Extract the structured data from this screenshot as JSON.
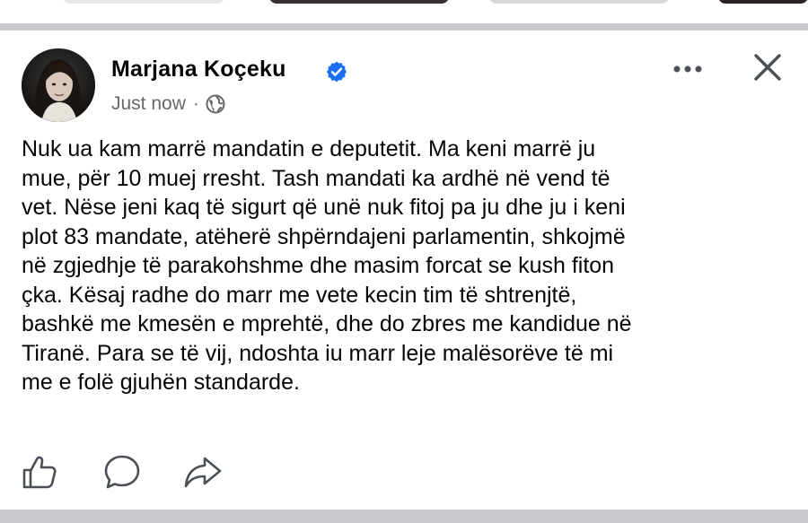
{
  "post": {
    "author": "Marjana Koçeku",
    "verified": true,
    "timestamp": "Just now",
    "separator": "·",
    "audience_icon": "globe-icon",
    "text_lines": [
      "Nuk ua kam marrë mandatin e deputetit. Ma keni marrë ju",
      "mue, për 10 muej rresht. Tash mandati ka ardhë në vend të",
      "vet. Nëse jeni kaq të sigurt që unë nuk fitoj pa ju dhe ju i keni",
      "plot 83 mandate, atëherë shpërndajeni parlamentin, shkojmë",
      "në zgjedhje të parakohshme dhe masim forcat se kush fiton",
      "çka. Kësaj radhe do marr me vete kecin tim të shtrenjtë,",
      "bashkë me kmesën e mprehtë, dhe do zbres me kandidue në",
      "Tiranë. Para se të vij, ndoshta iu marr leje malësorëve të mi",
      "me e folë gjuhën standarde."
    ]
  },
  "header_actions": {
    "more_icon": "more-icon",
    "close_icon": "close-icon"
  },
  "actions": {
    "like_icon": "like-icon",
    "comment_icon": "comment-icon",
    "share_icon": "share-icon"
  },
  "colors": {
    "verified_blue": "#1d6ff2",
    "secondary_text": "#65676b",
    "separator_gray": "#c9cbd0",
    "primary_text": "#050505"
  }
}
